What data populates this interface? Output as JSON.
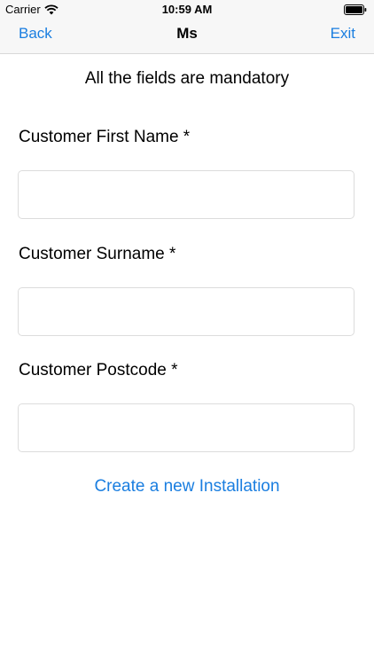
{
  "status_bar": {
    "carrier": "Carrier",
    "time": "10:59 AM",
    "icons": [
      "wifi-icon",
      "battery-icon"
    ]
  },
  "nav": {
    "back_label": "Back",
    "title": "Ms",
    "exit_label": "Exit"
  },
  "form": {
    "notice": "All the fields are mandatory",
    "fields": [
      {
        "label": "Customer First Name *",
        "value": "",
        "placeholder": ""
      },
      {
        "label": "Customer Surname *",
        "value": "",
        "placeholder": ""
      },
      {
        "label": "Customer Postcode *",
        "value": "",
        "placeholder": ""
      }
    ],
    "create_link": "Create a new Installation"
  },
  "colors": {
    "accent": "#1a7ee0",
    "bar_background": "#f7f7f7",
    "input_border": "#dcdcdc"
  }
}
